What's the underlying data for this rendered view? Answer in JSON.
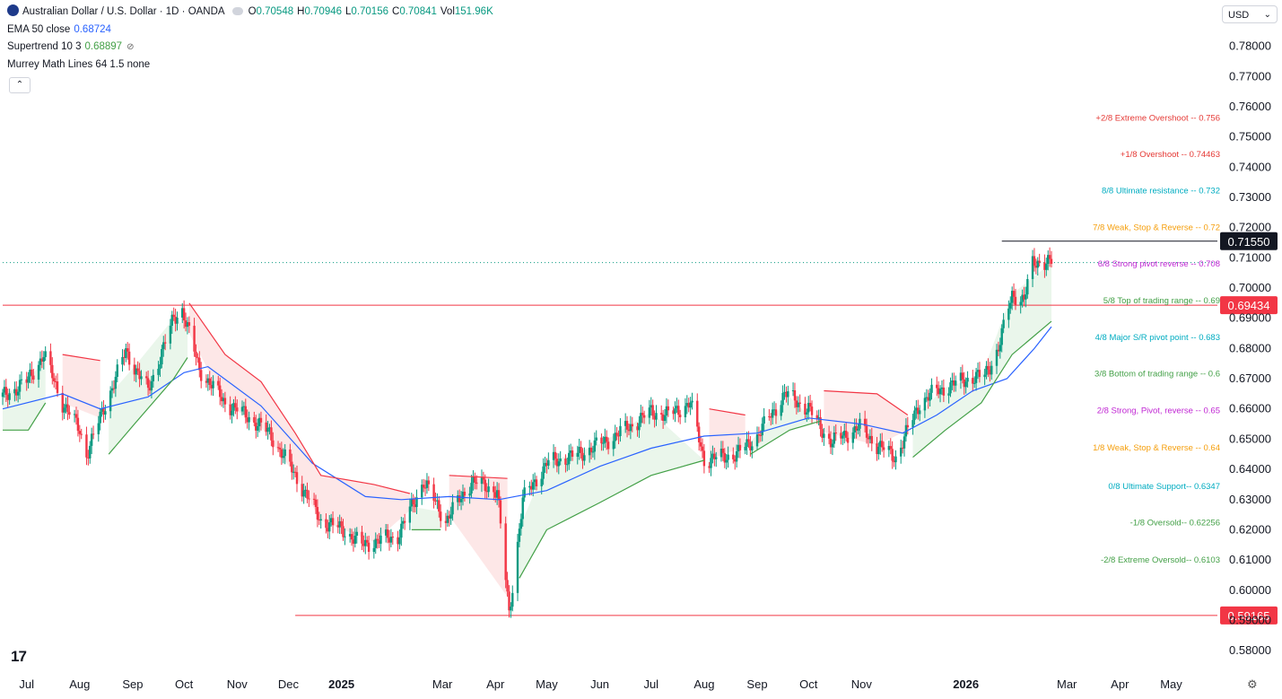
{
  "header": {
    "symbol_title": "Australian Dollar / U.S. Dollar · 1D · OANDA",
    "ohlc": [
      {
        "label": "O",
        "value": "0.70548"
      },
      {
        "label": "H",
        "value": "0.70946"
      },
      {
        "label": "L",
        "value": "0.70156"
      },
      {
        "label": "C",
        "value": "0.70841"
      },
      {
        "label": "Vol",
        "value": "151.96K"
      }
    ],
    "indicators": [
      {
        "label": "EMA 50 close",
        "value": "0.68724",
        "color": "#2962ff"
      },
      {
        "label": "Supertrend 10 3",
        "value": "0.68897",
        "color": "#43a047"
      },
      {
        "label": "Murrey Math Lines 64 1.5 none",
        "value": "",
        "color": "#131722"
      }
    ],
    "collapse_icon": "chevron-up-icon",
    "currency": "USD"
  },
  "colors": {
    "up": "#089981",
    "down": "#f23645",
    "ema": "#2962ff",
    "supertrend_up": "#43a047",
    "supertrend_down": "#f23645",
    "fill_up": "#e8f5e9",
    "fill_down": "#fde4e4"
  },
  "chart_data": {
    "type": "candlestick",
    "title": "Australian Dollar / U.S. Dollar · 1D · OANDA",
    "ylim": [
      0.575,
      0.787
    ],
    "y_ticks": [
      "0.78000",
      "0.77000",
      "0.76000",
      "0.75000",
      "0.74000",
      "0.73000",
      "0.72000",
      "0.71000",
      "0.70000",
      "0.69000",
      "0.68000",
      "0.67000",
      "0.66000",
      "0.65000",
      "0.64000",
      "0.63000",
      "0.62000",
      "0.61000",
      "0.60000",
      "0.59000",
      "0.58000"
    ],
    "x_ticks": [
      {
        "label": "Jul",
        "bold": false,
        "date": "2024-07-01"
      },
      {
        "label": "Aug",
        "bold": false,
        "date": "2024-08-01"
      },
      {
        "label": "Sep",
        "bold": false,
        "date": "2024-09-01"
      },
      {
        "label": "Oct",
        "bold": false,
        "date": "2024-10-01"
      },
      {
        "label": "Nov",
        "bold": false,
        "date": "2024-11-01"
      },
      {
        "label": "Dec",
        "bold": false,
        "date": "2024-12-01"
      },
      {
        "label": "2025",
        "bold": true,
        "date": "2025-01-01"
      },
      {
        "label": "Mar",
        "bold": false,
        "date": "2025-03-01"
      },
      {
        "label": "Apr",
        "bold": false,
        "date": "2025-04-01"
      },
      {
        "label": "May",
        "bold": false,
        "date": "2025-05-01"
      },
      {
        "label": "Jun",
        "bold": false,
        "date": "2025-06-01"
      },
      {
        "label": "Jul",
        "bold": false,
        "date": "2025-07-01"
      },
      {
        "label": "Aug",
        "bold": false,
        "date": "2025-08-01"
      },
      {
        "label": "Sep",
        "bold": false,
        "date": "2025-09-01"
      },
      {
        "label": "Oct",
        "bold": false,
        "date": "2025-10-01"
      },
      {
        "label": "Nov",
        "bold": false,
        "date": "2025-11-01"
      },
      {
        "label": "2026",
        "bold": true,
        "date": "2026-01-01"
      },
      {
        "label": "Mar",
        "bold": false,
        "date": "2026-03-01"
      },
      {
        "label": "Apr",
        "bold": false,
        "date": "2026-04-01"
      },
      {
        "label": "May",
        "bold": false,
        "date": "2026-05-01"
      }
    ],
    "price_series": [
      {
        "date": "2024-06-17",
        "value": 0.664
      },
      {
        "date": "2024-07-01",
        "value": 0.669
      },
      {
        "date": "2024-07-11",
        "value": 0.678
      },
      {
        "date": "2024-07-22",
        "value": 0.662
      },
      {
        "date": "2024-08-01",
        "value": 0.653
      },
      {
        "date": "2024-08-05",
        "value": 0.645
      },
      {
        "date": "2024-08-15",
        "value": 0.66
      },
      {
        "date": "2024-08-28",
        "value": 0.679
      },
      {
        "date": "2024-09-10",
        "value": 0.666
      },
      {
        "date": "2024-09-25",
        "value": 0.69
      },
      {
        "date": "2024-09-30",
        "value": 0.693
      },
      {
        "date": "2024-10-10",
        "value": 0.673
      },
      {
        "date": "2024-10-25",
        "value": 0.662
      },
      {
        "date": "2024-11-06",
        "value": 0.658
      },
      {
        "date": "2024-11-20",
        "value": 0.652
      },
      {
        "date": "2024-12-05",
        "value": 0.638
      },
      {
        "date": "2024-12-20",
        "value": 0.623
      },
      {
        "date": "2025-01-02",
        "value": 0.62
      },
      {
        "date": "2025-01-13",
        "value": 0.615
      },
      {
        "date": "2025-02-03",
        "value": 0.618
      },
      {
        "date": "2025-02-18",
        "value": 0.636
      },
      {
        "date": "2025-03-03",
        "value": 0.623
      },
      {
        "date": "2025-03-18",
        "value": 0.636
      },
      {
        "date": "2025-04-02",
        "value": 0.633
      },
      {
        "date": "2025-04-09",
        "value": 0.592
      },
      {
        "date": "2025-04-17",
        "value": 0.63
      },
      {
        "date": "2025-05-01",
        "value": 0.642
      },
      {
        "date": "2025-05-20",
        "value": 0.645
      },
      {
        "date": "2025-06-10",
        "value": 0.651
      },
      {
        "date": "2025-07-01",
        "value": 0.659
      },
      {
        "date": "2025-07-11",
        "value": 0.658
      },
      {
        "date": "2025-07-24",
        "value": 0.662
      },
      {
        "date": "2025-08-01",
        "value": 0.643
      },
      {
        "date": "2025-08-20",
        "value": 0.645
      },
      {
        "date": "2025-09-01",
        "value": 0.651
      },
      {
        "date": "2025-09-17",
        "value": 0.665
      },
      {
        "date": "2025-10-01",
        "value": 0.66
      },
      {
        "date": "2025-10-14",
        "value": 0.649
      },
      {
        "date": "2025-10-31",
        "value": 0.654
      },
      {
        "date": "2025-11-10",
        "value": 0.648
      },
      {
        "date": "2025-11-21",
        "value": 0.644
      },
      {
        "date": "2025-12-05",
        "value": 0.662
      },
      {
        "date": "2025-12-15",
        "value": 0.666
      },
      {
        "date": "2026-01-02",
        "value": 0.67
      },
      {
        "date": "2026-01-12",
        "value": 0.671
      },
      {
        "date": "2026-01-20",
        "value": 0.68
      },
      {
        "date": "2026-01-28",
        "value": 0.698
      },
      {
        "date": "2026-02-04",
        "value": 0.696
      },
      {
        "date": "2026-02-09",
        "value": 0.708
      },
      {
        "date": "2026-02-13",
        "value": 0.709
      },
      {
        "date": "2026-02-20",
        "value": 0.7084
      }
    ],
    "ema_series": [
      {
        "date": "2024-06-17",
        "value": 0.66
      },
      {
        "date": "2024-07-22",
        "value": 0.665
      },
      {
        "date": "2024-08-13",
        "value": 0.66
      },
      {
        "date": "2024-09-10",
        "value": 0.664
      },
      {
        "date": "2024-10-01",
        "value": 0.672
      },
      {
        "date": "2024-10-15",
        "value": 0.674
      },
      {
        "date": "2024-11-15",
        "value": 0.661
      },
      {
        "date": "2024-12-15",
        "value": 0.642
      },
      {
        "date": "2025-01-15",
        "value": 0.631
      },
      {
        "date": "2025-02-05",
        "value": 0.63
      },
      {
        "date": "2025-03-05",
        "value": 0.631
      },
      {
        "date": "2025-04-03",
        "value": 0.63
      },
      {
        "date": "2025-05-01",
        "value": 0.633
      },
      {
        "date": "2025-06-01",
        "value": 0.641
      },
      {
        "date": "2025-07-01",
        "value": 0.647
      },
      {
        "date": "2025-08-01",
        "value": 0.651
      },
      {
        "date": "2025-09-01",
        "value": 0.652
      },
      {
        "date": "2025-10-01",
        "value": 0.657
      },
      {
        "date": "2025-11-01",
        "value": 0.655
      },
      {
        "date": "2025-11-25",
        "value": 0.652
      },
      {
        "date": "2025-12-15",
        "value": 0.658
      },
      {
        "date": "2026-01-05",
        "value": 0.666
      },
      {
        "date": "2026-01-25",
        "value": 0.67
      },
      {
        "date": "2026-02-10",
        "value": 0.68
      },
      {
        "date": "2026-02-20",
        "value": 0.6872
      }
    ],
    "supertrend_segments": [
      {
        "trend": "up",
        "points": [
          {
            "date": "2024-06-17",
            "value": 0.653
          },
          {
            "date": "2024-07-02",
            "value": 0.653
          },
          {
            "date": "2024-07-12",
            "value": 0.662
          }
        ]
      },
      {
        "trend": "down",
        "points": [
          {
            "date": "2024-07-22",
            "value": 0.678
          },
          {
            "date": "2024-08-13",
            "value": 0.676
          }
        ]
      },
      {
        "date": "",
        "trend": "up",
        "points": [
          {
            "date": "2024-08-18",
            "value": 0.645
          },
          {
            "date": "2024-09-02",
            "value": 0.655
          },
          {
            "date": "2024-09-25",
            "value": 0.67
          },
          {
            "date": "2024-10-03",
            "value": 0.677
          }
        ]
      },
      {
        "trend": "down",
        "points": [
          {
            "date": "2024-10-04",
            "value": 0.695
          },
          {
            "date": "2024-10-25",
            "value": 0.678
          },
          {
            "date": "2024-11-15",
            "value": 0.669
          },
          {
            "date": "2024-12-05",
            "value": 0.652
          },
          {
            "date": "2024-12-20",
            "value": 0.638
          },
          {
            "date": "2025-01-20",
            "value": 0.635
          },
          {
            "date": "2025-02-10",
            "value": 0.632
          }
        ]
      },
      {
        "trend": "up",
        "points": [
          {
            "date": "2025-02-11",
            "value": 0.62
          },
          {
            "date": "2025-02-28",
            "value": 0.62
          }
        ]
      },
      {
        "trend": "down",
        "points": [
          {
            "date": "2025-03-05",
            "value": 0.638
          },
          {
            "date": "2025-04-08",
            "value": 0.637
          }
        ]
      },
      {
        "trend": "up",
        "points": [
          {
            "date": "2025-04-15",
            "value": 0.604
          },
          {
            "date": "2025-05-01",
            "value": 0.62
          },
          {
            "date": "2025-06-01",
            "value": 0.629
          },
          {
            "date": "2025-07-01",
            "value": 0.638
          },
          {
            "date": "2025-08-01",
            "value": 0.643
          }
        ]
      },
      {
        "trend": "down",
        "points": [
          {
            "date": "2025-08-04",
            "value": 0.66
          },
          {
            "date": "2025-08-25",
            "value": 0.658
          }
        ]
      },
      {
        "trend": "up",
        "points": [
          {
            "date": "2025-08-28",
            "value": 0.645
          },
          {
            "date": "2025-09-20",
            "value": 0.653
          },
          {
            "date": "2025-10-08",
            "value": 0.656
          }
        ]
      },
      {
        "trend": "down",
        "points": [
          {
            "date": "2025-10-10",
            "value": 0.666
          },
          {
            "date": "2025-11-10",
            "value": 0.665
          },
          {
            "date": "2025-11-28",
            "value": 0.658
          }
        ]
      },
      {
        "trend": "up",
        "points": [
          {
            "date": "2025-12-01",
            "value": 0.644
          },
          {
            "date": "2025-12-20",
            "value": 0.653
          },
          {
            "date": "2026-01-10",
            "value": 0.662
          },
          {
            "date": "2026-01-28",
            "value": 0.678
          },
          {
            "date": "2026-02-20",
            "value": 0.689
          }
        ]
      }
    ],
    "murrey_lines": [
      {
        "label": "+2/8 Extreme Overshoot --  0.756",
        "color": "#e53935",
        "price": 0.7565
      },
      {
        "label": "+1/8 Overshoot --  0.74463",
        "color": "#e53935",
        "price": 0.7446
      },
      {
        "label": "8/8 Ultimate resistance --  0.732",
        "color": "#00acc1",
        "price": 0.7325
      },
      {
        "label": "7/8 Weak, Stop & Reverse --  0.72",
        "color": "#f59e0b",
        "price": 0.7203
      },
      {
        "label": "6/8 Strong pivot reverse --  0.708",
        "color": "#c026d3",
        "price": 0.7083
      },
      {
        "label": "5/8 Top of trading range --  0.69",
        "color": "#43a047",
        "price": 0.6962
      },
      {
        "label": "4/8 Major S/R pivot point --  0.683",
        "color": "#00acc1",
        "price": 0.684
      },
      {
        "label": "3/8 Bottom of trading range --  0.6",
        "color": "#43a047",
        "price": 0.6719
      },
      {
        "label": "2/8 Strong, Pivot, reverse --  0.65",
        "color": "#c026d3",
        "price": 0.6598
      },
      {
        "label": "1/8 Weak, Stop & Reverse --  0.64",
        "color": "#f59e0b",
        "price": 0.6475
      },
      {
        "label": "0/8 Ultimate Support--  0.6347",
        "color": "#00acc1",
        "price": 0.6347
      },
      {
        "label": "-1/8 Oversold--  0.62256",
        "color": "#43a047",
        "price": 0.6226
      },
      {
        "label": "-2/8 Extreme Oversold--  0.6103",
        "color": "#43a047",
        "price": 0.6103
      }
    ],
    "horizontal_lines": [
      {
        "price": 0.7155,
        "label": "0.71550",
        "color": "#131722",
        "start_date": "2026-01-22"
      },
      {
        "price": 0.69434,
        "label": "0.69434",
        "color": "#f23645",
        "start_date": "2024-06-17"
      },
      {
        "price": 0.59165,
        "label": "0.59165",
        "color": "#f23645",
        "start_date": "2024-12-05"
      }
    ],
    "last_price": {
      "price": 0.70841,
      "color": "#089981"
    }
  }
}
